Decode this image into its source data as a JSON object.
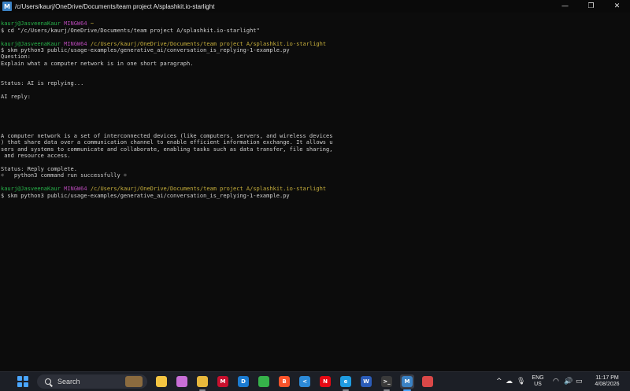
{
  "window": {
    "title": "/c/Users/kaurj/OneDrive/Documents/team project A/splashkit.io-starlight",
    "app_icon_letter": "M",
    "minimize_glyph": "—",
    "maximize_glyph": "❐",
    "close_glyph": "✕"
  },
  "terminal": {
    "blank": "",
    "prompt1": {
      "user": "kaurj@JasveenaKaur",
      "host": "MINGW64",
      "path": "~"
    },
    "cmd1": "$ cd \"/c/Users/kaurj/OneDrive/Documents/team project A/splashkit.io-starlight\"",
    "prompt2": {
      "user": "kaurj@JasveenaKaur",
      "host": "MINGW64",
      "path": "/c/Users/kaurj/OneDrive/Documents/team project A/splashkit.io-starlight"
    },
    "cmd2": "$ skm python3 public/usage-examples/generative_ai/conversation_is_replying-1-example.py",
    "question_label": "Question:",
    "question_text": "Explain what a computer network is in one short paragraph.",
    "status_replying": "Status: AI is replying...",
    "ai_reply_label": "AI reply:",
    "reply_line1": "A computer network is a set of interconnected devices (like computers, servers, and wireless devices",
    "reply_line2": ") that share data over a communication channel to enable efficient information exchange. It allows u",
    "reply_line3": "sers and systems to communicate and collaborate, enabling tasks such as data transfer, file sharing,",
    "reply_line4": " and resource access.",
    "status_complete": "Status: Reply complete.",
    "success_line": "☼   python3 command run successfully ☼",
    "prompt3": {
      "user": "kaurj@JasveenaKaur",
      "host": "MINGW64",
      "path": "/c/Users/kaurj/OneDrive/Documents/team project A/splashkit.io-starlight"
    },
    "cmd3": "$ skm python3 public/usage-examples/generative_ai/conversation_is_replying-1-example.py"
  },
  "taskbar": {
    "search_placeholder": "Search",
    "apps": [
      {
        "name": "file-explorer",
        "letter": "",
        "color": "#f4c542"
      },
      {
        "name": "copilot",
        "letter": "",
        "color": "#c96fd8"
      },
      {
        "name": "folder",
        "letter": "",
        "color": "#e8b83c"
      },
      {
        "name": "mcafee",
        "letter": "M",
        "color": "#c8102e"
      },
      {
        "name": "dell",
        "letter": "D",
        "color": "#1b7bd1"
      },
      {
        "name": "circle-app",
        "letter": "",
        "color": "#36b24a"
      },
      {
        "name": "brave",
        "letter": "B",
        "color": "#fb542b"
      },
      {
        "name": "vscode",
        "letter": "<",
        "color": "#2c8ad8"
      },
      {
        "name": "netflix",
        "letter": "N",
        "color": "#e50914"
      },
      {
        "name": "edge",
        "letter": "e",
        "color": "#1f9be0"
      },
      {
        "name": "word",
        "letter": "W",
        "color": "#2b5cb8"
      },
      {
        "name": "terminal",
        "letter": ">_",
        "color": "#3a3a3a"
      },
      {
        "name": "mingw",
        "letter": "M",
        "color": "#3b82c4"
      },
      {
        "name": "snipping",
        "letter": "",
        "color": "#d94848"
      }
    ],
    "lang_top": "ENG",
    "lang_bottom": "US",
    "time": "11:17 PM",
    "date": "4/08/2026"
  },
  "colors": {
    "prompt_user": "#27b34a",
    "prompt_host": "#b548b5",
    "prompt_path": "#c8b03c"
  }
}
